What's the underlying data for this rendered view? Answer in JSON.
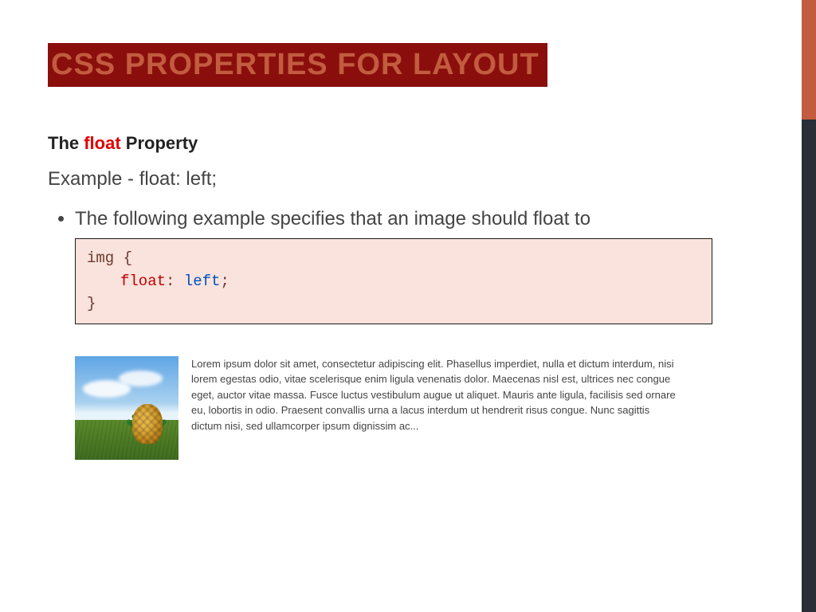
{
  "title": "CSS PROPERTIES FOR LAYOUT",
  "subheading": {
    "prefix": "The ",
    "keyword": "float",
    "suffix": " Property"
  },
  "example_line": "Example - float: left;",
  "bullet": "The following example specifies that an image should float to",
  "code": {
    "line1": "img {",
    "prop": "float",
    "colon": ": ",
    "val": "left",
    "semi": ";",
    "line3": "}"
  },
  "demo_text": "Lorem ipsum dolor sit amet, consectetur adipiscing elit. Phasellus imperdiet, nulla et dictum interdum, nisi lorem egestas odio, vitae scelerisque enim ligula venenatis dolor. Maecenas nisl est, ultrices nec congue eget, auctor vitae massa. Fusce luctus vestibulum augue ut aliquet. Mauris ante ligula, facilisis sed ornare eu, lobortis in odio. Praesent convallis urna a lacus interdum ut hendrerit risus congue. Nunc sagittis dictum nisi, sed ullamcorper ipsum dignissim ac..."
}
